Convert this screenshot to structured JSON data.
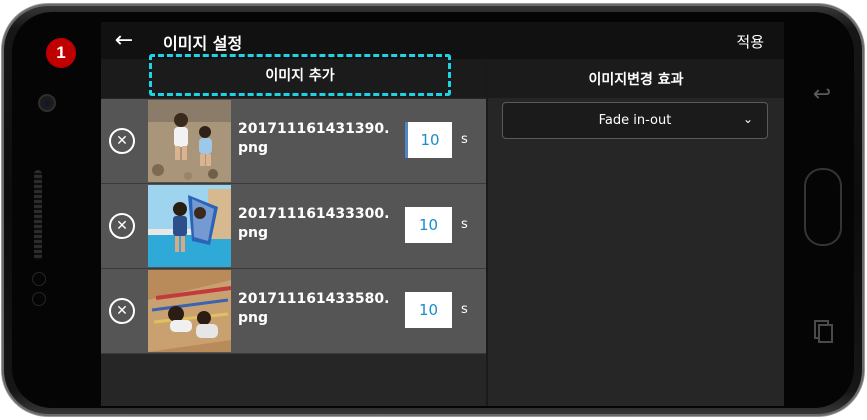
{
  "step_badge": "1",
  "header": {
    "back_glyph": "←",
    "title": "이미지 설정",
    "apply_label": "적용"
  },
  "left_panel": {
    "add_image_label": "이미지 추가",
    "items": [
      {
        "file_name": "201711161431390.png",
        "duration": "10",
        "unit": "s",
        "remove_glyph": "✕"
      },
      {
        "file_name": "201711161433300.png",
        "duration": "10",
        "unit": "s",
        "remove_glyph": "✕"
      },
      {
        "file_name": "201711161433580.png",
        "duration": "10",
        "unit": "s",
        "remove_glyph": "✕"
      }
    ]
  },
  "right_panel": {
    "header": "이미지변경 효과",
    "effect_selected": "Fade in-out",
    "chevron_glyph": "⌄"
  },
  "device": {
    "back_glyph": "↩"
  },
  "colors": {
    "highlight_dashed": "#1fd3e6",
    "badge": "#c00000",
    "duration_text": "#1a8ccc"
  },
  "icons": [
    "arrow-left-icon",
    "close-circle-icon",
    "chevron-down-icon",
    "hardware-back-icon",
    "hardware-recent-icon"
  ]
}
